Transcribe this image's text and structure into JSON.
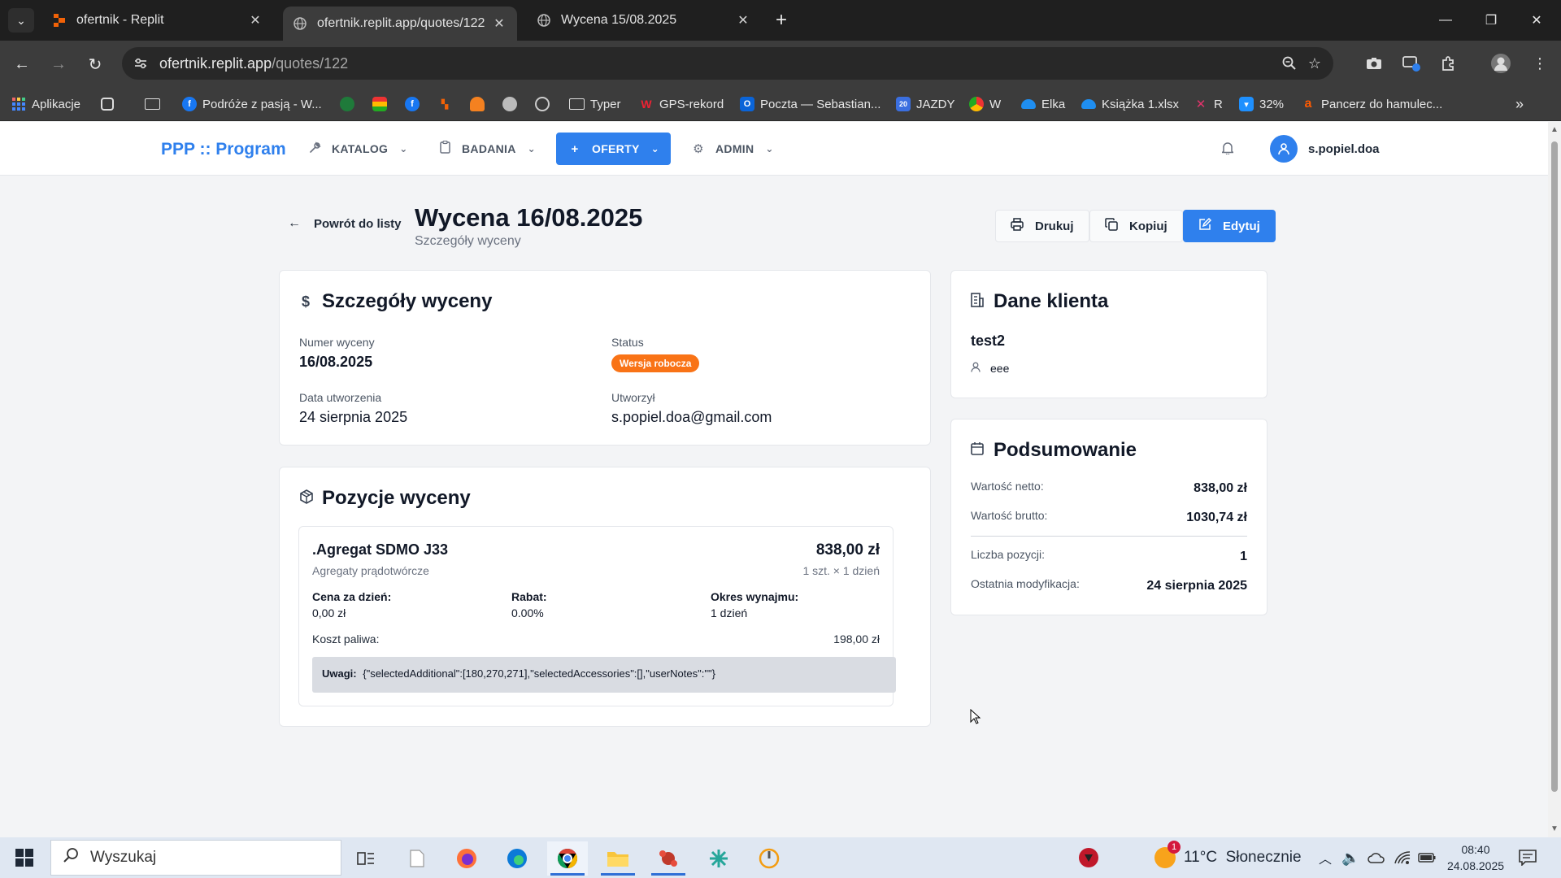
{
  "browser": {
    "tabs": [
      {
        "title": "ofertnik - Replit",
        "favicon": "replit-icon",
        "active": false
      },
      {
        "title": "ofertnik.replit.app/quotes/122",
        "favicon": "globe-icon",
        "active": true
      },
      {
        "title": "Wycena 15/08.2025",
        "favicon": "globe-icon",
        "active": false
      }
    ],
    "url_host": "ofertnik.replit.app",
    "url_path": "/quotes/122",
    "bookmarks": [
      {
        "label": "Aplikacje",
        "icon": "apps-grid-icon"
      },
      {
        "label": "",
        "icon": "grid-icon"
      },
      {
        "label": "",
        "icon": "folder-icon"
      },
      {
        "label": "Podróże z pasją - W...",
        "icon": "facebook-icon"
      },
      {
        "label": "",
        "icon": "green-circle-icon"
      },
      {
        "label": "",
        "icon": "bag-icon"
      },
      {
        "label": "",
        "icon": "facebook-icon"
      },
      {
        "label": "",
        "icon": "replit-icon"
      },
      {
        "label": "",
        "icon": "cloud-orange-icon"
      },
      {
        "label": "",
        "icon": "globe-icon"
      },
      {
        "label": "",
        "icon": "openai-icon"
      },
      {
        "label": "Typer",
        "icon": "folder-icon"
      },
      {
        "label": "GPS-rekord",
        "icon": "gps-icon"
      },
      {
        "label": "Poczta — Sebastian...",
        "icon": "outlook-icon"
      },
      {
        "label": "JAZDY",
        "icon": "calendar-icon"
      },
      {
        "label": "W",
        "icon": "chrome-icon"
      },
      {
        "label": "Elka",
        "icon": "onedrive-icon"
      },
      {
        "label": "Książka 1.xlsx",
        "icon": "onedrive-icon"
      },
      {
        "label": "R",
        "icon": "r-icon"
      },
      {
        "label": "32%",
        "icon": "gift-icon"
      },
      {
        "label": "Pancerz do hamulec...",
        "icon": "allegro-icon"
      }
    ]
  },
  "app": {
    "brand": "PPP :: Program",
    "nav": [
      {
        "label": "KATALOG",
        "icon": "wrench-icon"
      },
      {
        "label": "BADANIA",
        "icon": "clipboard-icon"
      },
      {
        "label": "OFERTY",
        "icon": "plus-icon"
      },
      {
        "label": "ADMIN",
        "icon": "gear-icon"
      }
    ],
    "user": "s.popiel.doa",
    "back_label": "Powrót do listy",
    "page_title": "Wycena 16/08.2025",
    "page_subtitle": "Szczegóły wyceny",
    "actions": {
      "print": "Drukuj",
      "copy": "Kopiuj",
      "edit": "Edytuj"
    }
  },
  "details": {
    "title": "Szczegóły wyceny",
    "number_label": "Numer wyceny",
    "number": "16/08.2025",
    "status_label": "Status",
    "status": "Wersja robocza",
    "created_label": "Data utworzenia",
    "created": "24 sierpnia 2025",
    "author_label": "Utworzył",
    "author": "s.popiel.doa@gmail.com"
  },
  "items_card": {
    "title": "Pozycje wyceny",
    "items": [
      {
        "name": ".Agregat SDMO J33",
        "category": "Agregaty prądotwórcze",
        "price": "838,00 zł",
        "qty": "1 szt. × 1 dzień",
        "day_price_label": "Cena za dzień:",
        "day_price": "0,00 zł",
        "discount_label": "Rabat:",
        "discount": "0.00%",
        "period_label": "Okres wynajmu:",
        "period": "1 dzień",
        "fuel_label": "Koszt paliwa:",
        "fuel": "198,00 zł",
        "notes_label": "Uwagi:",
        "notes": "{\"selectedAdditional\":[180,270,271],\"selectedAccessories\":[],\"userNotes\":\"\"}"
      }
    ]
  },
  "client": {
    "title": "Dane klienta",
    "name": "test2",
    "contact": "eee"
  },
  "summary": {
    "title": "Podsumowanie",
    "net_label": "Wartość netto:",
    "net": "838,00 zł",
    "gross_label": "Wartość brutto:",
    "gross": "1030,74 zł",
    "count_label": "Liczba pozycji:",
    "count": "1",
    "modified_label": "Ostatnia modyfikacja:",
    "modified": "24 sierpnia 2025"
  },
  "taskbar": {
    "search_placeholder": "Wyszukaj",
    "weather": "11°C  Słonecznie",
    "weather_badge": "1",
    "time": "08:40",
    "date": "24.08.2025"
  },
  "colors": {
    "accent": "#2f80ed",
    "status_draft": "#f97316"
  }
}
